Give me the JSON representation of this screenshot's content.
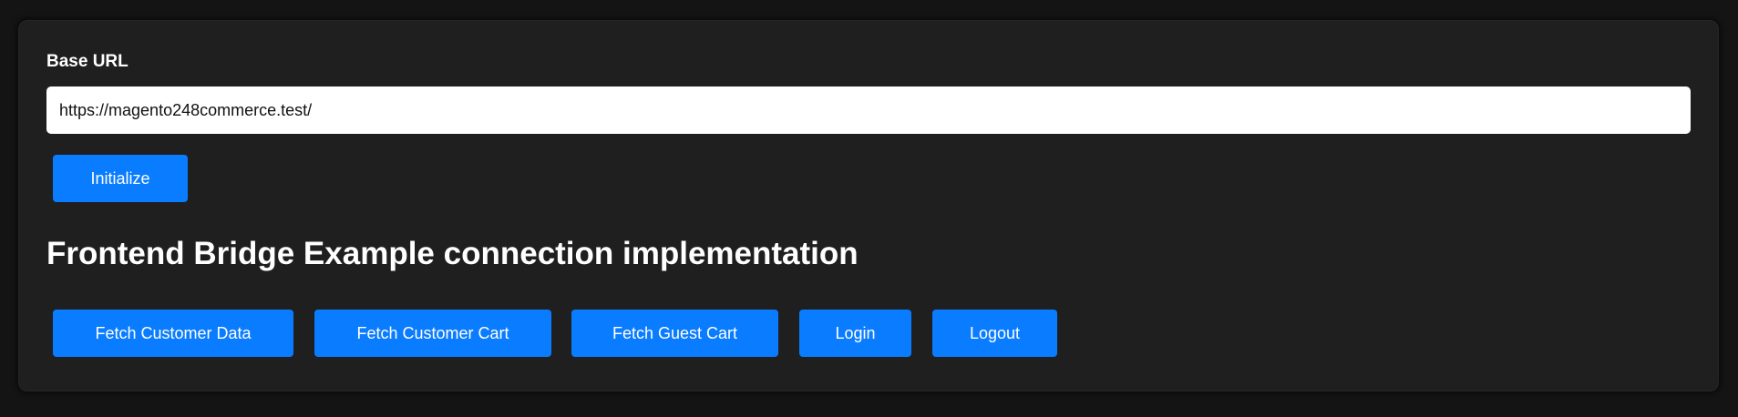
{
  "form": {
    "base_url_label": "Base URL",
    "base_url_value": "https://magento248commerce.test/",
    "initialize_label": "Initialize"
  },
  "section": {
    "title": "Frontend Bridge Example connection implementation"
  },
  "actions": [
    {
      "label": "Fetch Customer Data"
    },
    {
      "label": "Fetch Customer Cart"
    },
    {
      "label": "Fetch Guest Cart"
    },
    {
      "label": "Login"
    },
    {
      "label": "Logout"
    }
  ],
  "colors": {
    "page_background": "#141414",
    "panel_background": "#1f1f1f",
    "button_primary": "#0a7cff",
    "text": "#ffffff"
  }
}
